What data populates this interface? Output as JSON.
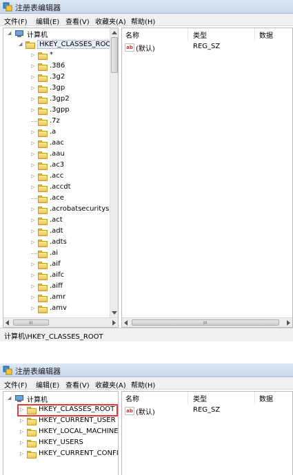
{
  "window1": {
    "title": "注册表编辑器",
    "menu": [
      "文件(F)",
      "编辑(E)",
      "查看(V)",
      "收藏夹(A)",
      "帮助(H)"
    ],
    "tree_root": "计算机",
    "selected_key": "HKEY_CLASSES_ROOT",
    "tree_items": [
      "*",
      ".386",
      ".3g2",
      ".3gp",
      ".3gp2",
      ".3gpp",
      ".7z",
      ".a",
      ".aac",
      ".aau",
      ".ac3",
      ".acc",
      ".accdt",
      ".ace",
      ".acrobatsecurityset",
      ".act",
      ".adt",
      ".adts",
      ".ai",
      ".aif",
      ".aifc",
      ".aiff",
      ".amr",
      ".amv"
    ],
    "columns": [
      "名称",
      "类型",
      "数据"
    ],
    "values": [
      {
        "icon": "ab",
        "name": "(默认)",
        "type": "REG_SZ",
        "data": ""
      }
    ],
    "status": "计算机\\HKEY_CLASSES_ROOT",
    "scrollbar_grip": "III"
  },
  "window2": {
    "title": "注册表编辑器",
    "menu": [
      "文件(F)",
      "编辑(E)",
      "查看(V)",
      "收藏夹(A)",
      "帮助(H)"
    ],
    "tree_root": "计算机",
    "tree_items": [
      "HKEY_CLASSES_ROOT",
      "HKEY_CURRENT_USER",
      "HKEY_LOCAL_MACHINE",
      "HKEY_USERS",
      "HKEY_CURRENT_CONFIG"
    ],
    "highlighted_item": "HKEY_CLASSES_ROOT",
    "highlight_color": "#e13a3a",
    "columns": [
      "名称",
      "类型",
      "数据"
    ],
    "values": [
      {
        "icon": "ab",
        "name": "(默认)",
        "type": "REG_SZ",
        "data": ""
      }
    ]
  }
}
